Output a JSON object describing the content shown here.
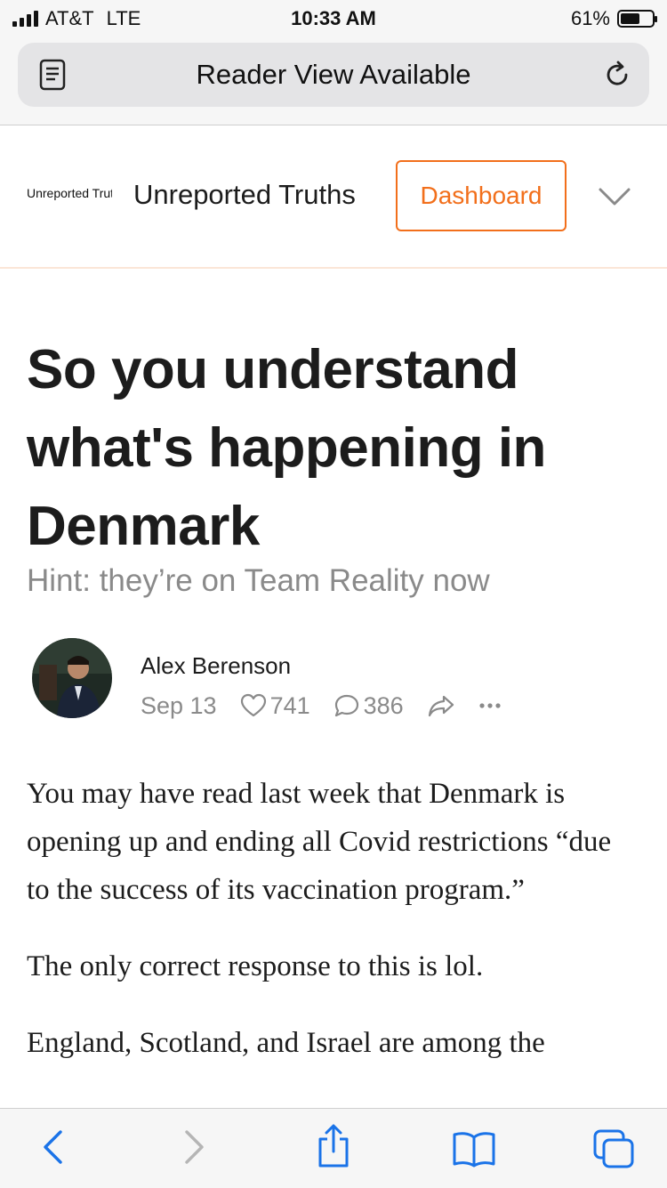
{
  "status_bar": {
    "carrier": "AT&T",
    "network": "LTE",
    "time": "10:33 AM",
    "battery": "61%",
    "battery_level": 0.61
  },
  "browser": {
    "title": "Reader View Available",
    "icons": {
      "reader": "reader-view-icon",
      "reload": "reload-icon"
    }
  },
  "site": {
    "logo_text": "Unreported Truths",
    "name": "Unreported Truths",
    "dashboard_label": "Dashboard",
    "accent_color": "#f26f1b"
  },
  "article": {
    "title": "So you understand what's happening in Denmark",
    "subtitle": "Hint: they’re on Team Reality now",
    "author": "Alex Berenson",
    "date": "Sep 13",
    "likes": "741",
    "comments": "386",
    "paragraphs": [
      "You may have read last week that Denmark is opening up and ending all Covid restrictions “due to the success of its vaccination program.”",
      "The only correct response to this is lol.",
      "England, Scotland, and Israel are among the"
    ]
  },
  "toolbar": {
    "icons": [
      "back-icon",
      "forward-icon",
      "share-icon",
      "bookmarks-icon",
      "tabs-icon"
    ]
  }
}
